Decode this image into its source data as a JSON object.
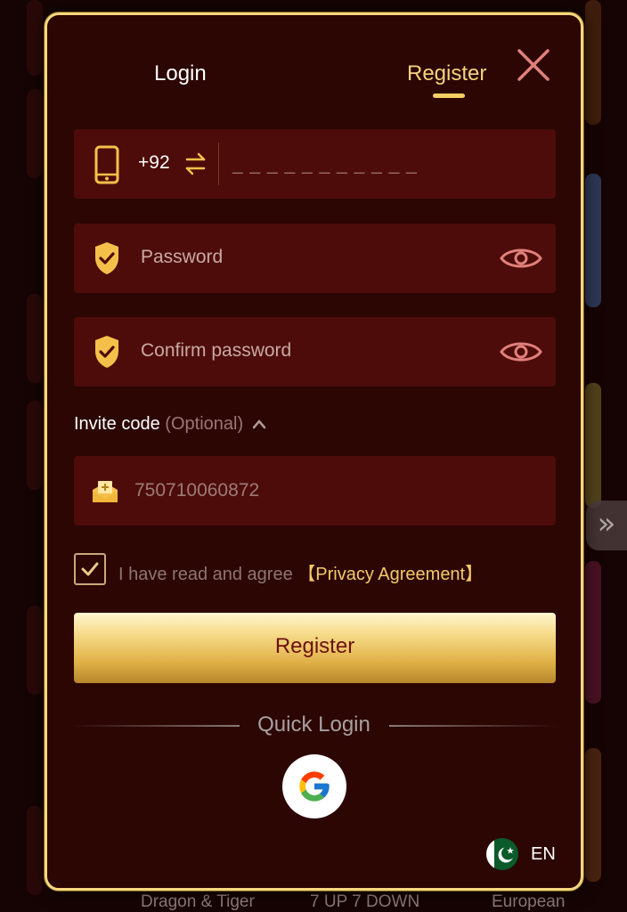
{
  "tabs": {
    "login": "Login",
    "register": "Register"
  },
  "phone": {
    "country_code": "+92",
    "placeholder": "_ _ _ _ _ _ _ _ _ _ _"
  },
  "password": {
    "placeholder": "Password"
  },
  "confirm_password": {
    "placeholder": "Confirm password"
  },
  "invite": {
    "label": "Invite code",
    "optional": "(Optional)",
    "value": "750710060872"
  },
  "agreement": {
    "text": "I have read and agree",
    "link": "【Privacy Agreement】",
    "checked": true
  },
  "register_button": "Register",
  "quick_login": {
    "label": "Quick Login",
    "provider_icon": "google-icon"
  },
  "language": {
    "code": "EN",
    "flag_icon": "pakistan-flag-icon"
  },
  "background": {
    "captions": [
      "Dragon & Tiger",
      "7 UP 7 DOWN",
      "European"
    ]
  },
  "colors": {
    "accent": "#f5d77e",
    "panel": "#2b0603",
    "field": "#4d0c09",
    "button_text": "#6b120c"
  }
}
